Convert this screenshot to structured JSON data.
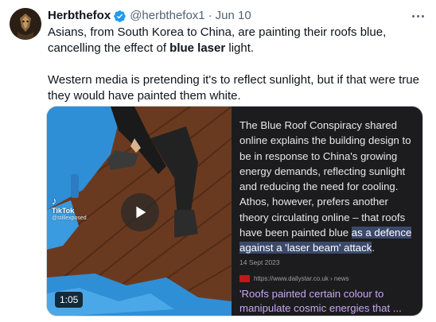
{
  "tweet": {
    "display_name": "Herbthefox",
    "handle": "@herbthefox1",
    "separator": "·",
    "date": "Jun 10",
    "text_line1_pre": "Asians, from South Korea to China, are painting their roofs blue, cancelling the effect of ",
    "text_line1_bold": "blue laser",
    "text_line1_post": " light.",
    "text_para2": "Western media is pretending it's to reflect sunlight, but if that were true they would have painted them white."
  },
  "video": {
    "tiktok_logo": "♪",
    "tiktok_name": "TikTok",
    "tiktok_handle": "@stillexposed",
    "duration": "1:05"
  },
  "article": {
    "body_pre": "The Blue Roof Conspiracy shared online explains the building design to be in response to China's growing energy demands, reflecting sunlight and reducing the need for cooling. Athos, however, prefers another theory circulating online – that roofs have been painted blue ",
    "body_highlight": "as a defence against a 'laser beam' attack",
    "body_post": ".",
    "date": "14 Sept 2023",
    "source_url": "https://www.dailystar.co.uk › news",
    "headline": "'Roofs painted certain colour to manipulate cosmic energies that ..."
  },
  "colors": {
    "verified_blue": "#1d9bf0",
    "article_bg": "#1c1c1e",
    "headline_purple": "#c7a7f2",
    "roof_blue": "#2f8fd6",
    "roof_brown": "#6a3a20"
  },
  "icons": {
    "verified": "verified-badge-icon",
    "more": "more-dots-icon",
    "play": "play-icon",
    "source": "dailystar-favicon"
  }
}
